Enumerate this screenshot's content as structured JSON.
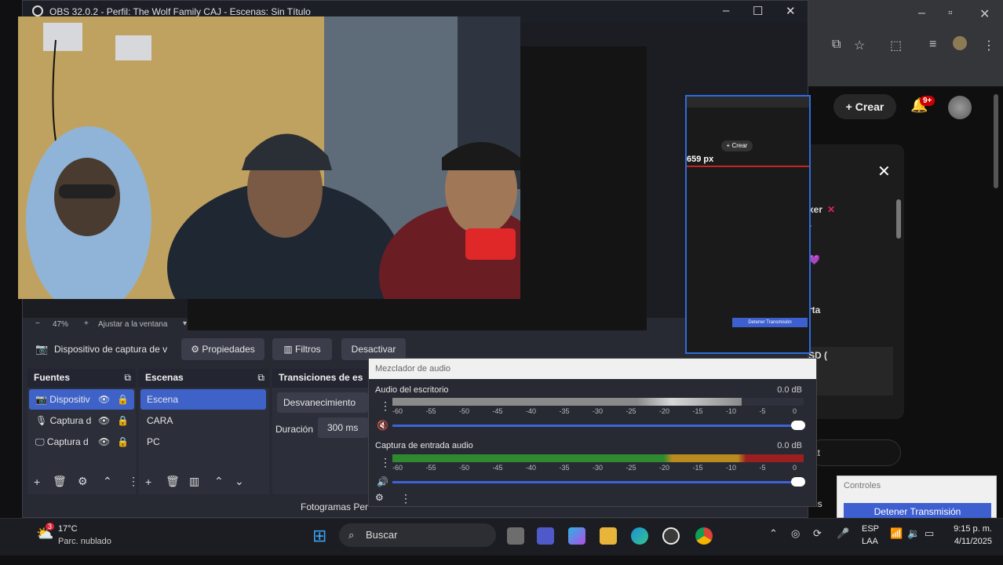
{
  "obs": {
    "title": "OBS 32.0.2 - Perfil: The Wolf Family CAJ - Escenas: Sin Título",
    "zoom": "47%",
    "fit_label": "Ajustar a la ventana",
    "source_name": "Dispositivo de captura de v",
    "properties_label": "Propiedades",
    "filters_label": "Filtros",
    "deactivate_label": "Desactivar",
    "sources_header": "Fuentes",
    "sources": [
      "Dispositiv",
      "Captura d",
      "Captura d"
    ],
    "scenes_header": "Escenas",
    "scenes": [
      "Escena",
      "CARA",
      "PC"
    ],
    "transitions_header": "Transiciones de es",
    "transition": "Desvanecimiento",
    "duration_label": "Duración",
    "duration_value": "300 ms",
    "status_text": "Fotogramas Per",
    "status_tail": "ess"
  },
  "mixer": {
    "title": "Mezclador de audio",
    "ch1_name": "Audio del escritorio",
    "ch1_db": "0.0 dB",
    "ch2_name": "Captura de entrada audio",
    "ch2_db": "0.0 dB",
    "ticks": [
      "-60",
      "-55",
      "-50",
      "-45",
      "-40",
      "-35",
      "-30",
      "-25",
      "-20",
      "-15",
      "-10",
      "-5",
      "0"
    ],
    "ch1_level": 0.85,
    "ch2_level": 1.0
  },
  "nested": {
    "px_label": "659 px",
    "stop_label": "Detener Transmisión"
  },
  "controls": {
    "title": "Controles",
    "stop_button": "Detener Transmisión"
  },
  "chrome": {
    "create_label": "Crear",
    "notif_count": "9+",
    "chat_fragments": [
      "xer",
      "-",
      "",
      "rta",
      "SD (",
      "S",
      "at"
    ]
  },
  "taskbar": {
    "temp": "17°C",
    "weather": "Parc. nublado",
    "weather_badge": "3",
    "search": "Buscar",
    "lang1": "ESP",
    "lang2": "LAA",
    "time": "9:15 p. m.",
    "date": "4/11/2025"
  },
  "colors": {
    "accent": "#3f62c9",
    "youtube_red": "#cc0000"
  }
}
